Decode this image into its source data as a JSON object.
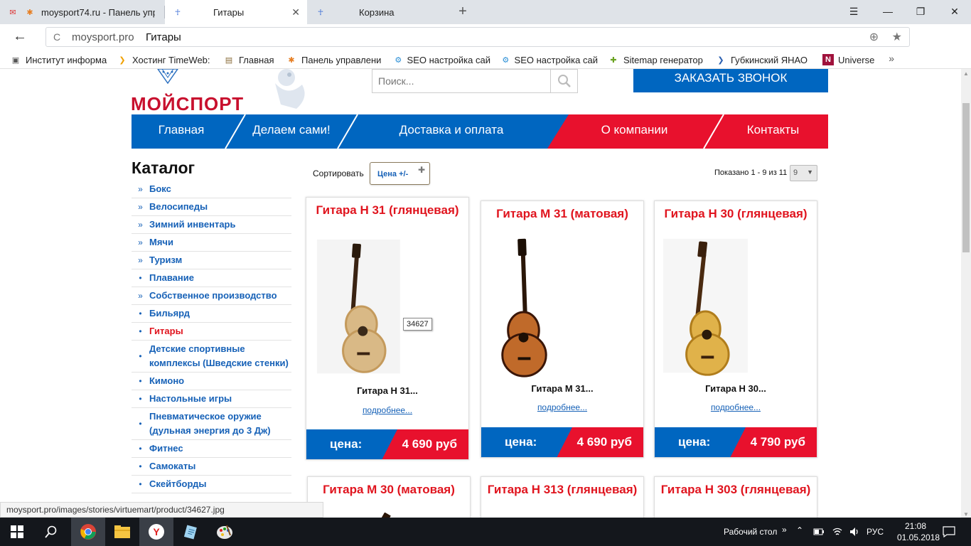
{
  "browser": {
    "tabs": [
      {
        "title": "moysport74.ru - Панель упр"
      },
      {
        "title": "Гитары"
      },
      {
        "title": "Корзина"
      }
    ],
    "address": {
      "host": "moysport.pro",
      "title": "Гитары"
    },
    "bookmarks": [
      {
        "label": "Институт информа"
      },
      {
        "label": "Хостинг TimeWeb:"
      },
      {
        "label": "Главная"
      },
      {
        "label": "Панель управлени"
      },
      {
        "label": "SEO настройка сай"
      },
      {
        "label": "SEO настройка сай"
      },
      {
        "label": "Sitemap генератор"
      },
      {
        "label": "Губкинский ЯНАО"
      },
      {
        "label": "Universe"
      }
    ]
  },
  "header": {
    "logo_text": "МОЙСПОРТ",
    "search_placeholder": "Поиск...",
    "call_button": "ЗАКАЗАТЬ ЗВОНОК"
  },
  "nav": [
    {
      "label": "Главная",
      "color": "#0066c0"
    },
    {
      "label": "Делаем сами!",
      "color": "#0066c0"
    },
    {
      "label": "Доставка и оплата",
      "color": "#0066c0"
    },
    {
      "label": "О компании",
      "color": "#e8112d"
    },
    {
      "label": "Контакты",
      "color": "#e8112d"
    }
  ],
  "catalog": {
    "title": "Каталог",
    "items": [
      {
        "label": "Бокс",
        "bullet": "»"
      },
      {
        "label": "Велосипеды",
        "bullet": "»"
      },
      {
        "label": "Зимний инвентарь",
        "bullet": "»"
      },
      {
        "label": "Мячи",
        "bullet": "»"
      },
      {
        "label": "Туризм",
        "bullet": "»"
      },
      {
        "label": "Плавание",
        "bullet": "•"
      },
      {
        "label": "Собственное производство",
        "bullet": "»"
      },
      {
        "label": "Бильярд",
        "bullet": "•"
      },
      {
        "label": "Гитары",
        "bullet": "•"
      },
      {
        "label": "Детские спортивные комплексы (Шведские стенки)",
        "bullet": "•"
      },
      {
        "label": "Кимоно",
        "bullet": "•"
      },
      {
        "label": "Настольные игры",
        "bullet": "•"
      },
      {
        "label": "Пневматическое оружие (дульная энергия до 3 Дж)",
        "bullet": "•"
      },
      {
        "label": "Фитнес",
        "bullet": "•"
      },
      {
        "label": "Самокаты",
        "bullet": "•"
      },
      {
        "label": "Скейтборды",
        "bullet": "•"
      }
    ]
  },
  "sorting": {
    "label": "Сортировать",
    "button": "Цена +/-",
    "shown": "Показано 1 - 9 из 11",
    "per_page": "9"
  },
  "products": [
    {
      "title": "Гитара Н 31 (глянцевая)",
      "short": "Гитара Н 31...",
      "more": "подробнее...",
      "price_label": "цена:",
      "price": "4 690 руб",
      "body_color": "#d9b986",
      "edge_color": "#c49a5c"
    },
    {
      "title": "Гитара М 31 (матовая)",
      "short": "Гитара М 31...",
      "more": "подробнее...",
      "price_label": "цена:",
      "price": "4 690 руб",
      "body_color": "#c06a2a",
      "edge_color": "#3a1608"
    },
    {
      "title": "Гитара Н 30 (глянцевая)",
      "short": "Гитара Н 30...",
      "more": "подробнее...",
      "price_label": "цена:",
      "price": "4 790 руб",
      "body_color": "#e0b24a",
      "edge_color": "#b07d1c"
    },
    {
      "title": "Гитара М 30 (матовая)"
    },
    {
      "title": "Гитара Н 313 (глянцевая)"
    },
    {
      "title": "Гитара Н 303 (глянцевая)"
    }
  ],
  "tooltip": "34627",
  "status_url": "moysport.pro/images/stories/virtuemart/product/34627.jpg",
  "taskbar": {
    "desktop_label": "Рабочий стол",
    "lang": "РУС",
    "time": "21:08",
    "date": "01.05.2018"
  }
}
